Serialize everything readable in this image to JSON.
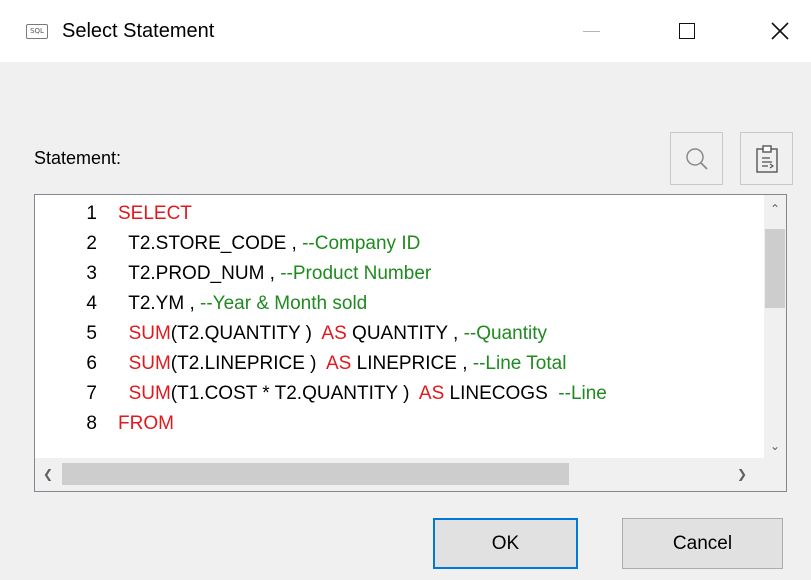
{
  "window": {
    "title": "Select Statement",
    "icon_label": "SQL"
  },
  "statement": {
    "label": "Statement:"
  },
  "toolbar": {
    "search_icon": "search-icon",
    "paste_icon": "paste-icon"
  },
  "code_lines": [
    {
      "num": "1",
      "tokens": [
        {
          "t": "SELECT",
          "c": "kw"
        }
      ]
    },
    {
      "num": "2",
      "tokens": [
        {
          "t": "  T2.STORE_CODE , ",
          "c": ""
        },
        {
          "t": "--Company ID",
          "c": "cm"
        }
      ]
    },
    {
      "num": "3",
      "tokens": [
        {
          "t": "  T2.PROD_NUM , ",
          "c": ""
        },
        {
          "t": "--Product Number",
          "c": "cm"
        }
      ]
    },
    {
      "num": "4",
      "tokens": [
        {
          "t": "  T2.YM , ",
          "c": ""
        },
        {
          "t": "--Year & Month sold",
          "c": "cm"
        }
      ]
    },
    {
      "num": "5",
      "tokens": [
        {
          "t": "  ",
          "c": ""
        },
        {
          "t": "SUM",
          "c": "kw"
        },
        {
          "t": "(T2.QUANTITY )  ",
          "c": ""
        },
        {
          "t": "AS",
          "c": "kw"
        },
        {
          "t": " QUANTITY , ",
          "c": ""
        },
        {
          "t": "--Quantity",
          "c": "cm"
        }
      ]
    },
    {
      "num": "6",
      "tokens": [
        {
          "t": "  ",
          "c": ""
        },
        {
          "t": "SUM",
          "c": "kw"
        },
        {
          "t": "(T2.LINEPRICE )  ",
          "c": ""
        },
        {
          "t": "AS",
          "c": "kw"
        },
        {
          "t": " LINEPRICE , ",
          "c": ""
        },
        {
          "t": "--Line Total",
          "c": "cm"
        }
      ]
    },
    {
      "num": "7",
      "tokens": [
        {
          "t": "  ",
          "c": ""
        },
        {
          "t": "SUM",
          "c": "kw"
        },
        {
          "t": "(T1.COST * T2.QUANTITY )  ",
          "c": ""
        },
        {
          "t": "AS",
          "c": "kw"
        },
        {
          "t": " LINECOGS  ",
          "c": ""
        },
        {
          "t": "--Line",
          "c": "cm"
        }
      ]
    },
    {
      "num": "8",
      "tokens": [
        {
          "t": "FROM",
          "c": "kw"
        }
      ]
    }
  ],
  "colors": {
    "keyword": "#e2191c",
    "comment": "#1f8a1f",
    "accent": "#0078d7"
  },
  "buttons": {
    "ok": "OK",
    "cancel": "Cancel"
  }
}
